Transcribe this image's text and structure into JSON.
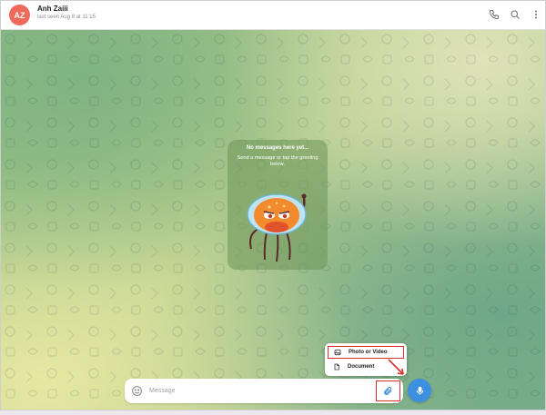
{
  "header": {
    "avatar_initials": "AZ",
    "avatar_color": "#ef6a5a",
    "contact_name": "Anh Zaiii",
    "last_seen": "last seen Aug 8 at 11:15",
    "icons": [
      "phone-icon",
      "search-icon",
      "more-vertical-icon"
    ]
  },
  "empty_state": {
    "title": "No messages here yet...",
    "subtitle": "Send a message or tap the greeting below.",
    "sticker": "jellyfish-sticker"
  },
  "attach_menu": {
    "items": [
      {
        "label": "Photo or Video",
        "icon": "image-icon"
      },
      {
        "label": "Document",
        "icon": "document-icon"
      }
    ]
  },
  "composer": {
    "placeholder": "Message",
    "value": "",
    "emoji_icon": "emoji-icon",
    "attach_icon": "paperclip-icon",
    "send_icon": "microphone-icon"
  },
  "colors": {
    "accent": "#3d8fe0",
    "highlight": "#d9302c"
  }
}
